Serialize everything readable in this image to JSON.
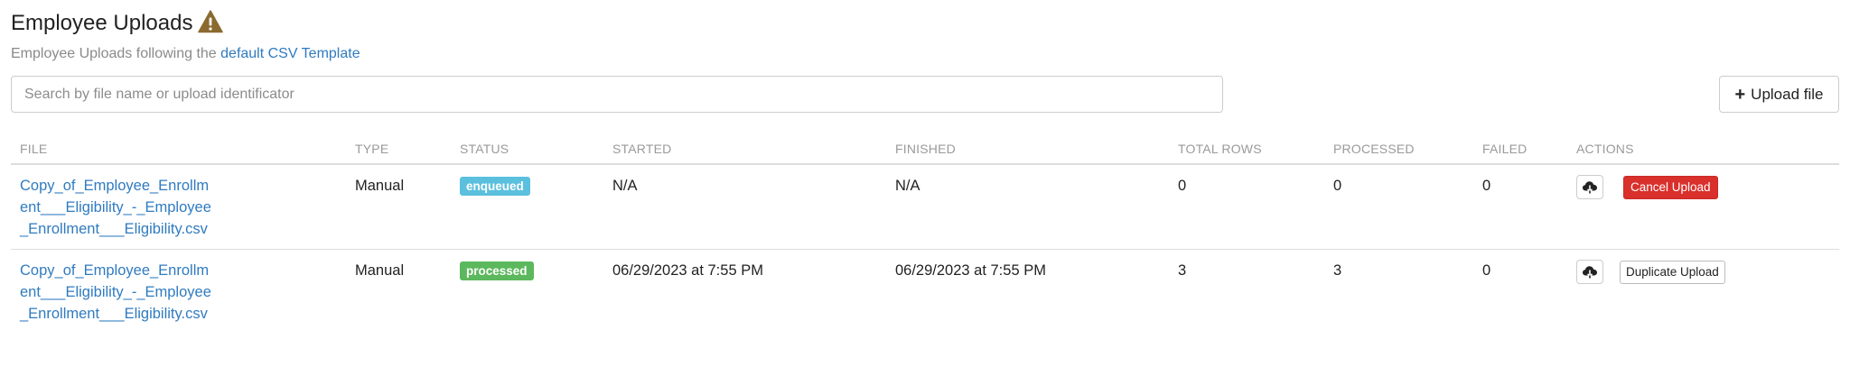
{
  "header": {
    "title": "Employee Uploads",
    "subtitle_prefix": "Employee Uploads following the",
    "template_link": "default CSV Template",
    "warning_icon": "warning-triangle-icon",
    "warning_color": "#8b6a2f"
  },
  "search": {
    "placeholder": "Search by file name or upload identificator",
    "value": ""
  },
  "upload_button": {
    "icon": "plus-icon",
    "label": "Upload file"
  },
  "table": {
    "columns": [
      "FILE",
      "TYPE",
      "STATUS",
      "STARTED",
      "FINISHED",
      "TOTAL ROWS",
      "PROCESSED",
      "FAILED",
      "ACTIONS"
    ],
    "rows": [
      {
        "file": "Copy_of_Employee_Enrollment___Eligibility_-_Employee_Enrollment___Eligibility.csv",
        "type": "Manual",
        "status": "enqueued",
        "status_color": "#5bc0de",
        "started": "N/A",
        "finished": "N/A",
        "total_rows": "0",
        "processed": "0",
        "failed": "0",
        "download_icon": "cloud-download-icon",
        "action_label": "Cancel Upload"
      },
      {
        "file": "Copy_of_Employee_Enrollment___Eligibility_-_Employee_Enrollment___Eligibility.csv",
        "type": "Manual",
        "status": "processed",
        "status_color": "#5cb85c",
        "started": "06/29/2023 at 7:55 PM",
        "finished": "06/29/2023 at 7:55 PM",
        "total_rows": "3",
        "processed": "3",
        "failed": "0",
        "download_icon": "cloud-download-icon",
        "action_label": "Duplicate Upload"
      }
    ]
  },
  "colors": {
    "link": "#2f7bc0",
    "danger": "#d9302c"
  }
}
